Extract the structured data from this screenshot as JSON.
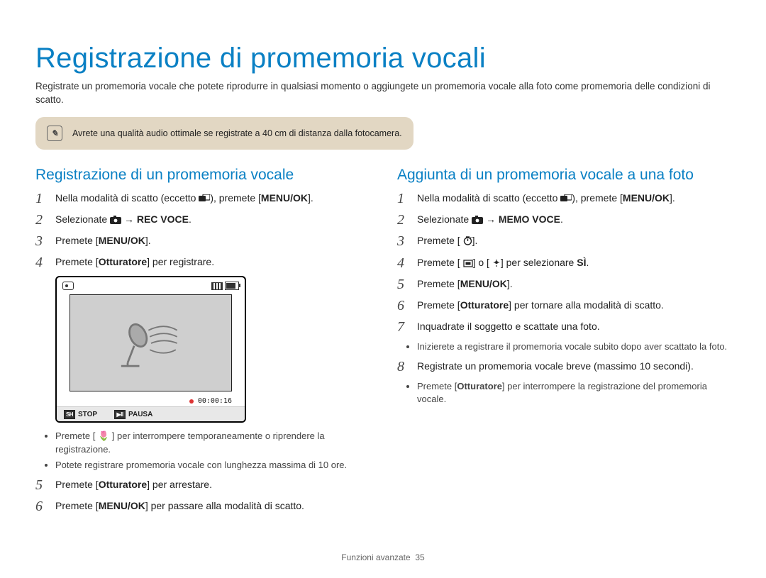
{
  "title": "Registrazione di promemoria vocali",
  "intro": "Registrate un promemoria vocale che potete riprodurre in qualsiasi momento o aggiungete un promemoria vocale alla foto come promemoria delle condizioni di scatto.",
  "note": {
    "text": "Avrete una qualità audio ottimale se registrate a 40 cm di distanza dalla fotocamera."
  },
  "left": {
    "heading": "Registrazione di un promemoria vocale",
    "steps": {
      "s1a": "Nella modalità di scatto (eccetto ",
      "s1b": "), premete [",
      "s1c": "].",
      "s1_btn": "MENU/OK",
      "s2a": "Selezionate ",
      "s2b": " → ",
      "s2c": ".",
      "s2_target": "REC VOCE",
      "s3a": "Premete [",
      "s3_btn": "MENU/OK",
      "s3b": "].",
      "s4a": "Premete [",
      "s4_btn": "Otturatore",
      "s4b": "] per registrare.",
      "bullets": [
        "Premete [ 🌷 ] per interrompere temporaneamente o riprendere la registrazione.",
        "Potete registrare promemoria vocale con lunghezza massima di 10 ore."
      ],
      "s5a": "Premete [",
      "s5_btn": "Otturatore",
      "s5b": "] per arrestare.",
      "s6a": "Premete [",
      "s6_btn": "MENU/OK",
      "s6b": "] per passare alla modalità di scatto."
    },
    "screen": {
      "time": "00:00:16",
      "stop": "STOP",
      "pause": "PAUSA"
    }
  },
  "right": {
    "heading": "Aggiunta di un promemoria vocale a una foto",
    "steps": {
      "s1a": "Nella modalità di scatto (eccetto ",
      "s1b": "), premete [",
      "s1c": "].",
      "s1_btn": "MENU/OK",
      "s2a": "Selezionate ",
      "s2b": " → ",
      "s2c": ".",
      "s2_target": "MEMO VOCE",
      "s3a": "Premete [",
      "s3b": "].",
      "s4a": "Premete [",
      "s4b": "] o [",
      "s4c": "] per selezionare ",
      "s4d": ".",
      "s4_target": "SÌ",
      "s5a": "Premete [",
      "s5_btn": "MENU/OK",
      "s5b": "].",
      "s6a": "Premete [",
      "s6_btn": "Otturatore",
      "s6b": "] per tornare alla modalità di scatto.",
      "s7": "Inquadrate il soggetto e scattate una foto.",
      "s7_bullet": "Inizierete a registrare il promemoria vocale subito dopo aver scattato la foto.",
      "s8": "Registrate un promemoria vocale breve (massimo 10 secondi).",
      "s8_bullet_a": "Premete [",
      "s8_bullet_btn": "Otturatore",
      "s8_bullet_b": "] per interrompere la registrazione del promemoria vocale."
    }
  },
  "footer": {
    "section": "Funzioni avanzate",
    "page": "35"
  }
}
